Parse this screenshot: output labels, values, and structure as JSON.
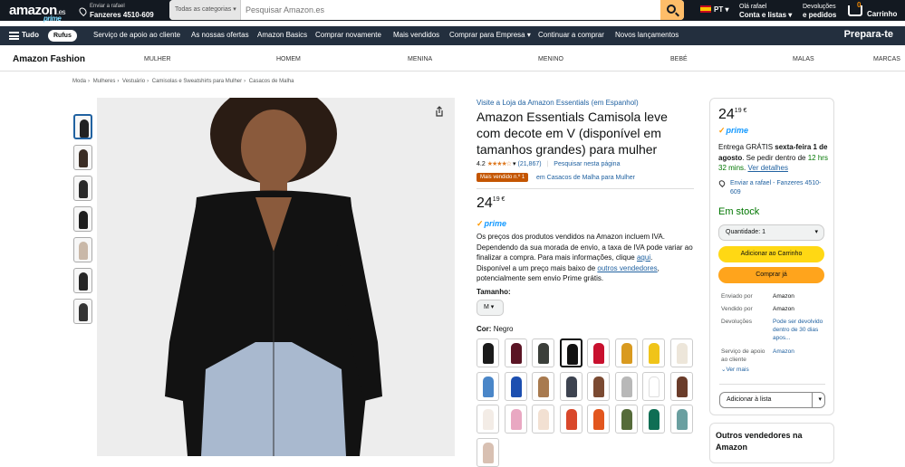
{
  "nav": {
    "logo": "amazon",
    "logo_suffix": ".es",
    "logo_prime": "prime",
    "deliver_line1": "Enviar a rafael",
    "deliver_line2": "Fanzeres 4510-609",
    "search_category": "Todas as categorias",
    "search_placeholder": "Pesquisar Amazon.es",
    "language": "PT",
    "account_line1": "Olá rafael",
    "account_line2": "Conta e listas",
    "returns_line1": "Devoluções",
    "returns_line2": "e pedidos",
    "cart_count": "0",
    "cart_label": "Carrinho"
  },
  "nav2": {
    "all": "Tudo",
    "rufus": "Rufus",
    "items": [
      "Serviço de apoio ao cliente",
      "As nossas ofertas",
      "Amazon Basics",
      "Comprar novamente",
      "Mais vendidos",
      "Comprar para Empresa",
      "Continuar a comprar",
      "Novos lançamentos"
    ],
    "promo": "Prepara-te"
  },
  "fashion": {
    "brand": "Amazon Fashion",
    "items": [
      "MULHER",
      "HOMEM",
      "MENINA",
      "MENINO",
      "BEBÉ",
      "MALAS",
      "MARCAS"
    ]
  },
  "breadcrumbs": [
    "Moda",
    "Mulheres",
    "Vestuário",
    "Camisolas e Sweatshirts para Mulher",
    "Casacos de Malha"
  ],
  "product": {
    "store_link": "Visite a Loja da Amazon Essentials (em Espanhol)",
    "title": "Amazon Essentials Camisola leve com decote em V (disponível em tamanhos grandes) para mulher",
    "rating": "4.2",
    "stars": "★★★★☆",
    "reviews": "(21,867)",
    "search_page": "Pesquisar nesta página",
    "best_badge": "Mais vendido n.º 1",
    "best_cat": "em Casacos de Malha para Mulher",
    "price_whole": "24",
    "price_frac": "19 €",
    "prime": "prime",
    "iva_text_1": "Os preços dos produtos vendidos na Amazon incluem IVA. Dependendo da sua morada de envio, a taxa de IVA pode variar ao finalizar a compra. Para mais informações, clique ",
    "iva_link": "aqui",
    "iva_text_2": ".",
    "avail_text": "Disponível a um preço mais baixo de ",
    "avail_link": "outros vendedores",
    "avail_text_2": ", potencialmente sem envio Prime grátis.",
    "size_label": "Tamanho:",
    "size_value": "M",
    "color_label": "Cor:",
    "color_value": "Negro"
  },
  "swatches": [
    "#1a1a1a",
    "#5a1424",
    "#3b3f3a",
    "#111111",
    "#c8102e",
    "#d99a1f",
    "#f0c419",
    "#ede6da",
    "#4a86c8",
    "#1c4fb0",
    "#a87a4f",
    "#3d4350",
    "#7b4a32",
    "#b8b8b8",
    "#ffffff",
    "#6a3c2a",
    "#f3ece6",
    "#e9a8c2",
    "#f2e0d2",
    "#d9482b",
    "#e2561e",
    "#556b3a",
    "#0f6e54",
    "#6a9fa0",
    "#d8c0b2"
  ],
  "selected_swatch": 3,
  "buybox": {
    "price_whole": "24",
    "price_frac": "19 €",
    "prime": "prime",
    "deliv_1": "Entrega GRÁTIS ",
    "deliv_date": "sexta-feira 1 de agosto",
    "deliv_2": ". Se pedir dentro de ",
    "deliv_time": "12 hrs 32 mins",
    "deliv_3": ". ",
    "deliv_link": "Ver detalhes",
    "ship_to": "Enviar a rafael - Fanzeres 4510-609",
    "stock": "Em stock",
    "qty_label": "Quantidade:",
    "qty_value": "1",
    "add_cart": "Adicionar ao Carrinho",
    "buy_now": "Comprar já",
    "info": [
      {
        "k": "Enviado por",
        "v": "Amazon"
      },
      {
        "k": "Vendido por",
        "v": "Amazon"
      },
      {
        "k": "Devoluções",
        "v": "Pode ser devolvido dentro de 30 dias apos..."
      },
      {
        "k": "Serviço de apoio ao cliente",
        "v": "Amazon"
      }
    ],
    "ver_mais": "Ver mais",
    "add_list": "Adicionar à lista",
    "outros": "Outros vendedores na Amazon"
  }
}
